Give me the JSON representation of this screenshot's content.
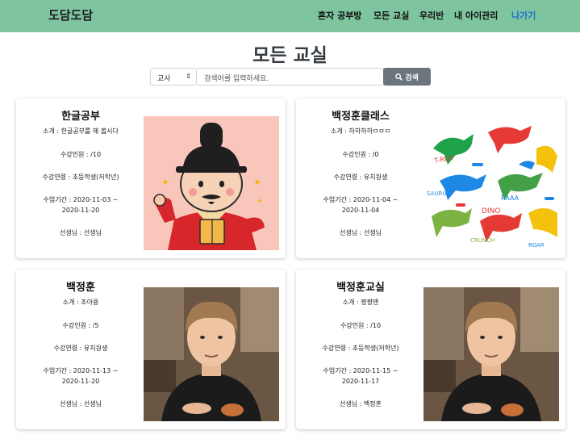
{
  "nav": {
    "brand": "도담도담",
    "items": [
      "혼자 공부방",
      "모든 교실",
      "우리반",
      "내 아이관리",
      "나가기"
    ]
  },
  "page_title": "모든 교실",
  "search": {
    "select_value": "교사",
    "placeholder": "검색어를 입력하세요.",
    "button_label": "검색"
  },
  "cards": [
    {
      "title": "한글공부",
      "desc": "소개 : 한글공부를 해 봅시다",
      "capacity": "수강인원 : /10",
      "age": "수강연령 : 초등학생(저학년)",
      "period_1": "수업기간 : 2020-11-03 ~",
      "period_2": "2020-11-20",
      "teacher": "선생님 : 선생님"
    },
    {
      "title": "백정훈클래스",
      "desc": "소개 : 하하하하ㅁㅁㅁ",
      "capacity": "수강인원 : /0",
      "age": "수강연령 : 유치원생",
      "period_1": "수업기간 : 2020-11-04 ~",
      "period_2": "2020-11-04",
      "teacher": "선생님 : 선생님"
    },
    {
      "title": "백정훈",
      "desc": "소개 : 조아용",
      "capacity": "수강인원 : /5",
      "age": "수강연령 : 유치원생",
      "period_1": "수업기간 : 2020-11-13 ~",
      "period_2": "2020-11-20",
      "teacher": "선생님 : 선생님"
    },
    {
      "title": "백정훈교실",
      "desc": "소개 : 짱짱맨",
      "capacity": "수강인원 : /10",
      "age": "수강연령 : 초등학생(저학년)",
      "period_1": "수업기간 : 2020-11-15 ~",
      "period_2": "2020-11-17",
      "teacher": "선생님 : 백정훈"
    }
  ],
  "dino_words": [
    "T-REX",
    "RAAA",
    "DINO",
    "CRUNCH",
    "SAURUS",
    "ROAR"
  ],
  "icons": {
    "search_button": "search-icon",
    "select_caret": "chevron-updown-icon"
  },
  "colors": {
    "navbar": "#7dc49f",
    "logout_link": "#1a6fd1",
    "search_button": "#6c757d"
  }
}
